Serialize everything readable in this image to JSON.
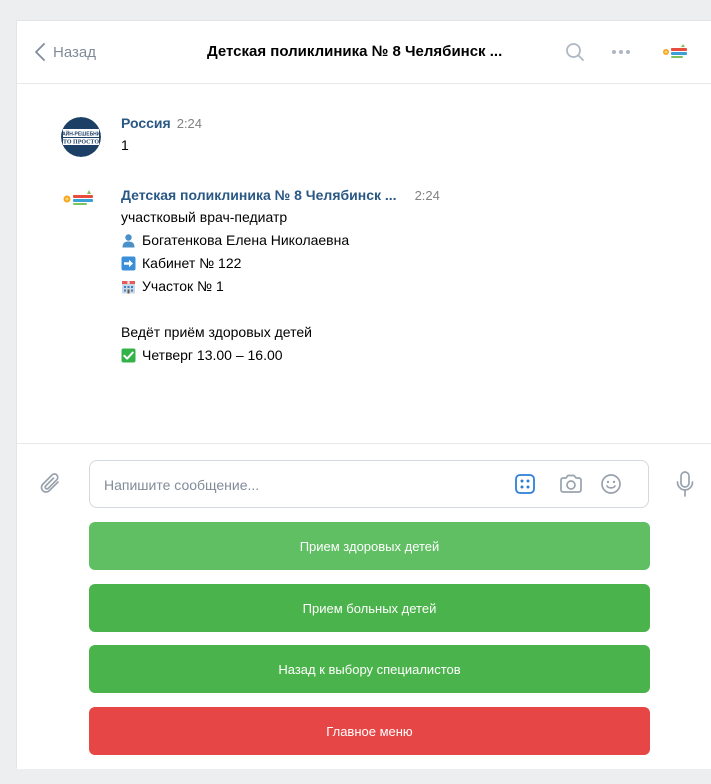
{
  "header": {
    "back_label": "Назад",
    "title": "Детская поликлиника № 8 Челябинск ..."
  },
  "messages": [
    {
      "author": "Россия",
      "time": "2:24",
      "avatar_text": [
        "ЛАЙН-РЕШЕБНИК",
        "ТО ПРОСТО"
      ],
      "lines": [
        "1"
      ]
    },
    {
      "author": "Детская поликлиника № 8 Челябинск ...",
      "time": "2:24",
      "lines": [
        {
          "icon": "person-icon",
          "text": "участковый врач-педиатр"
        },
        {
          "icon": "person-icon",
          "text": "Богатенкова Елена Николаевна"
        },
        {
          "icon": "arrow-right-icon",
          "text": "Кабинет № 122"
        },
        {
          "icon": "hospital-icon",
          "text": "Участок № 1"
        },
        {
          "icon": "",
          "text": "Ведёт приём здоровых детей"
        },
        {
          "icon": "checkmark-icon",
          "text": "Четверг 13.00 – 16.00"
        }
      ]
    }
  ],
  "composer": {
    "placeholder": "Напишите сообщение...",
    "value": ""
  },
  "keyboard": {
    "buttons": [
      {
        "label": "Прием здоровых детей",
        "color": "#5fbf62"
      },
      {
        "label": "Прием больных детей",
        "color": "#4bb34b"
      },
      {
        "label": "Назад к выбору специалистов",
        "color": "#4bb34b"
      },
      {
        "label": "Главное меню",
        "color": "#e64646"
      }
    ]
  },
  "colors": {
    "link": "#2a5885",
    "muted": "#818c99",
    "background": "#edeef0"
  }
}
